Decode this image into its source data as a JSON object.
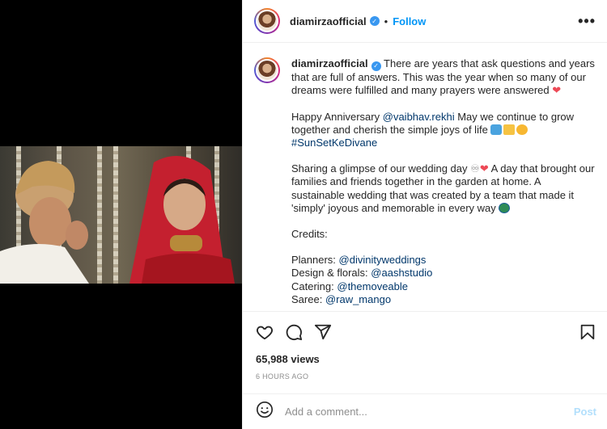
{
  "post": {
    "username": "diamirzaofficial",
    "dot": "•",
    "follow_label": "Follow",
    "more_label": "•••"
  },
  "caption": {
    "username": "diamirzaofficial",
    "p1": "There are years that ask questions and years that are full of answers. This was the year when so many of our dreams were fulfilled and many prayers were answered",
    "p2_start": "Happy Anniversary",
    "p2_mention": "@vaibhav.rekhi",
    "p2_rest": "May we continue to grow together and cherish the simple joys of life",
    "hashtag": "#SunSetKeDivane",
    "p3_start": "Sharing a glimpse of our wedding day",
    "p3_rest": "A day that brought our families and friends together in the garden at home. A sustainable wedding that was created by a team that made it 'simply' joyous and memorable in every way",
    "credits_title": "Credits:",
    "credits": [
      {
        "label": "Planners:",
        "handle": "@divinityweddings"
      },
      {
        "label": "Design & florals:",
        "handle": "@aashstudio"
      },
      {
        "label": "Catering:",
        "handle": "@themoveable"
      },
      {
        "label": "Saree:",
        "handle": "@raw_mango"
      }
    ]
  },
  "stats": {
    "views": "65,988 views",
    "time": "6 HOURS AGO"
  },
  "comment": {
    "placeholder": "Add a comment...",
    "post_label": "Post"
  },
  "icons": {
    "like": "heart-outline",
    "comment": "speech-bubble",
    "share": "paper-plane",
    "save": "bookmark",
    "emoji": "smiley-face"
  },
  "colors": {
    "accent": "#0095f6",
    "link": "#00376b",
    "muted": "#8e8e8e",
    "border": "#efefef",
    "post_disabled": "#b2dffc"
  }
}
